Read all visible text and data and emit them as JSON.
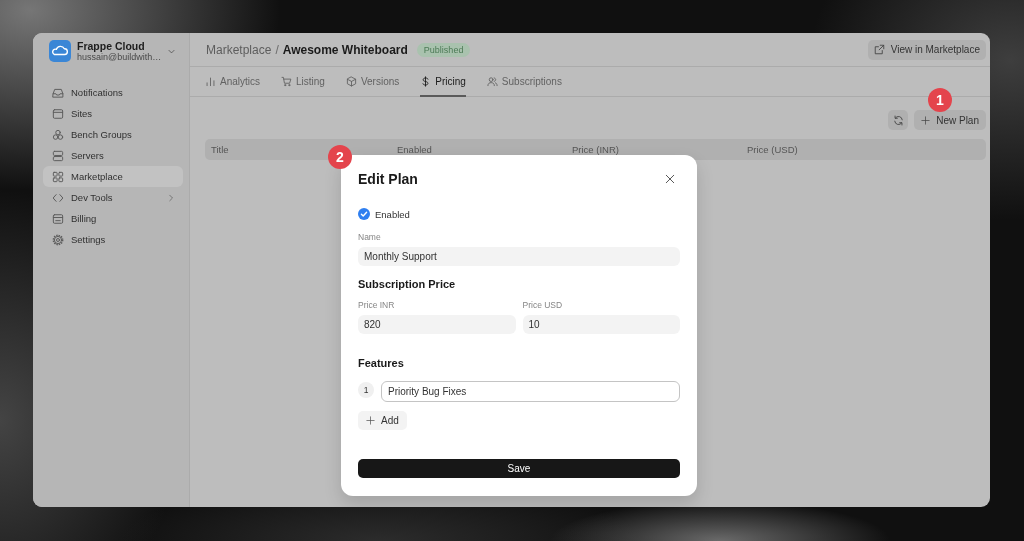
{
  "sidebar": {
    "account": {
      "name": "Frappe Cloud",
      "email": "hussain@buildwith…"
    },
    "items": [
      {
        "label": "Notifications",
        "selected": false,
        "has_submenu": false
      },
      {
        "label": "Sites",
        "selected": false,
        "has_submenu": false
      },
      {
        "label": "Bench Groups",
        "selected": false,
        "has_submenu": false
      },
      {
        "label": "Servers",
        "selected": false,
        "has_submenu": false
      },
      {
        "label": "Marketplace",
        "selected": true,
        "has_submenu": false
      },
      {
        "label": "Dev Tools",
        "selected": false,
        "has_submenu": true
      },
      {
        "label": "Billing",
        "selected": false,
        "has_submenu": false
      },
      {
        "label": "Settings",
        "selected": false,
        "has_submenu": false
      }
    ]
  },
  "header": {
    "breadcrumb": {
      "parent": "Marketplace",
      "separator": "/",
      "current": "Awesome Whiteboard"
    },
    "status_badge": "Published",
    "action_button": "View in Marketplace"
  },
  "tabs": [
    {
      "label": "Analytics",
      "selected": false
    },
    {
      "label": "Listing",
      "selected": false
    },
    {
      "label": "Versions",
      "selected": false
    },
    {
      "label": "Pricing",
      "selected": true
    },
    {
      "label": "Subscriptions",
      "selected": false
    }
  ],
  "toolbar": {
    "new_button": "New Plan",
    "callout": "1"
  },
  "table": {
    "columns": [
      "Title",
      "Enabled",
      "Price (INR)",
      "Price (USD)"
    ]
  },
  "modal": {
    "callout": "2",
    "title": "Edit Plan",
    "enabled": {
      "label": "Enabled",
      "checked": true
    },
    "name_field": {
      "label": "Name",
      "value": "Monthly Support"
    },
    "price_section": {
      "title": "Subscription Price",
      "fields": [
        {
          "label": "Price INR",
          "value": "820"
        },
        {
          "label": "Price USD",
          "value": "10"
        }
      ]
    },
    "features": {
      "title": "Features",
      "items": [
        {
          "number": "1",
          "value": "Priority Bug Fixes",
          "focused": true
        }
      ],
      "add_button": "Add"
    },
    "save_button": "Save"
  }
}
